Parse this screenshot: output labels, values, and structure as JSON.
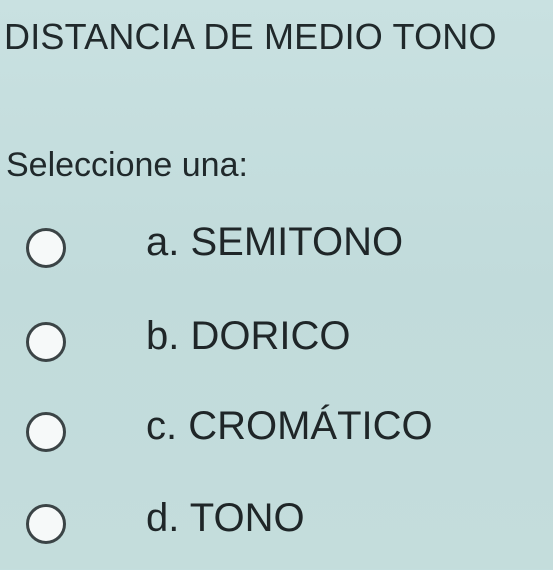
{
  "question": {
    "text": "DISTANCIA DE MEDIO TONO"
  },
  "prompt": "Seleccione una:",
  "options": [
    {
      "letter": "a.",
      "label": "SEMITONO",
      "display": "a. SEMITONO",
      "selected": false
    },
    {
      "letter": "b.",
      "label": "DORICO",
      "display": "b. DORICO",
      "selected": false
    },
    {
      "letter": "c.",
      "label": "CROMÁTICO",
      "display": "c. CROMÁTICO",
      "selected": false
    },
    {
      "letter": "d.",
      "label": "TONO",
      "display": "d. TONO",
      "selected": false
    }
  ],
  "colors": {
    "background": "#c4dede",
    "text": "#20292b",
    "radio_border": "#3b4446",
    "radio_fill": "#f6f9f9"
  },
  "icons": {
    "radio": "radio-unchecked-icon"
  }
}
